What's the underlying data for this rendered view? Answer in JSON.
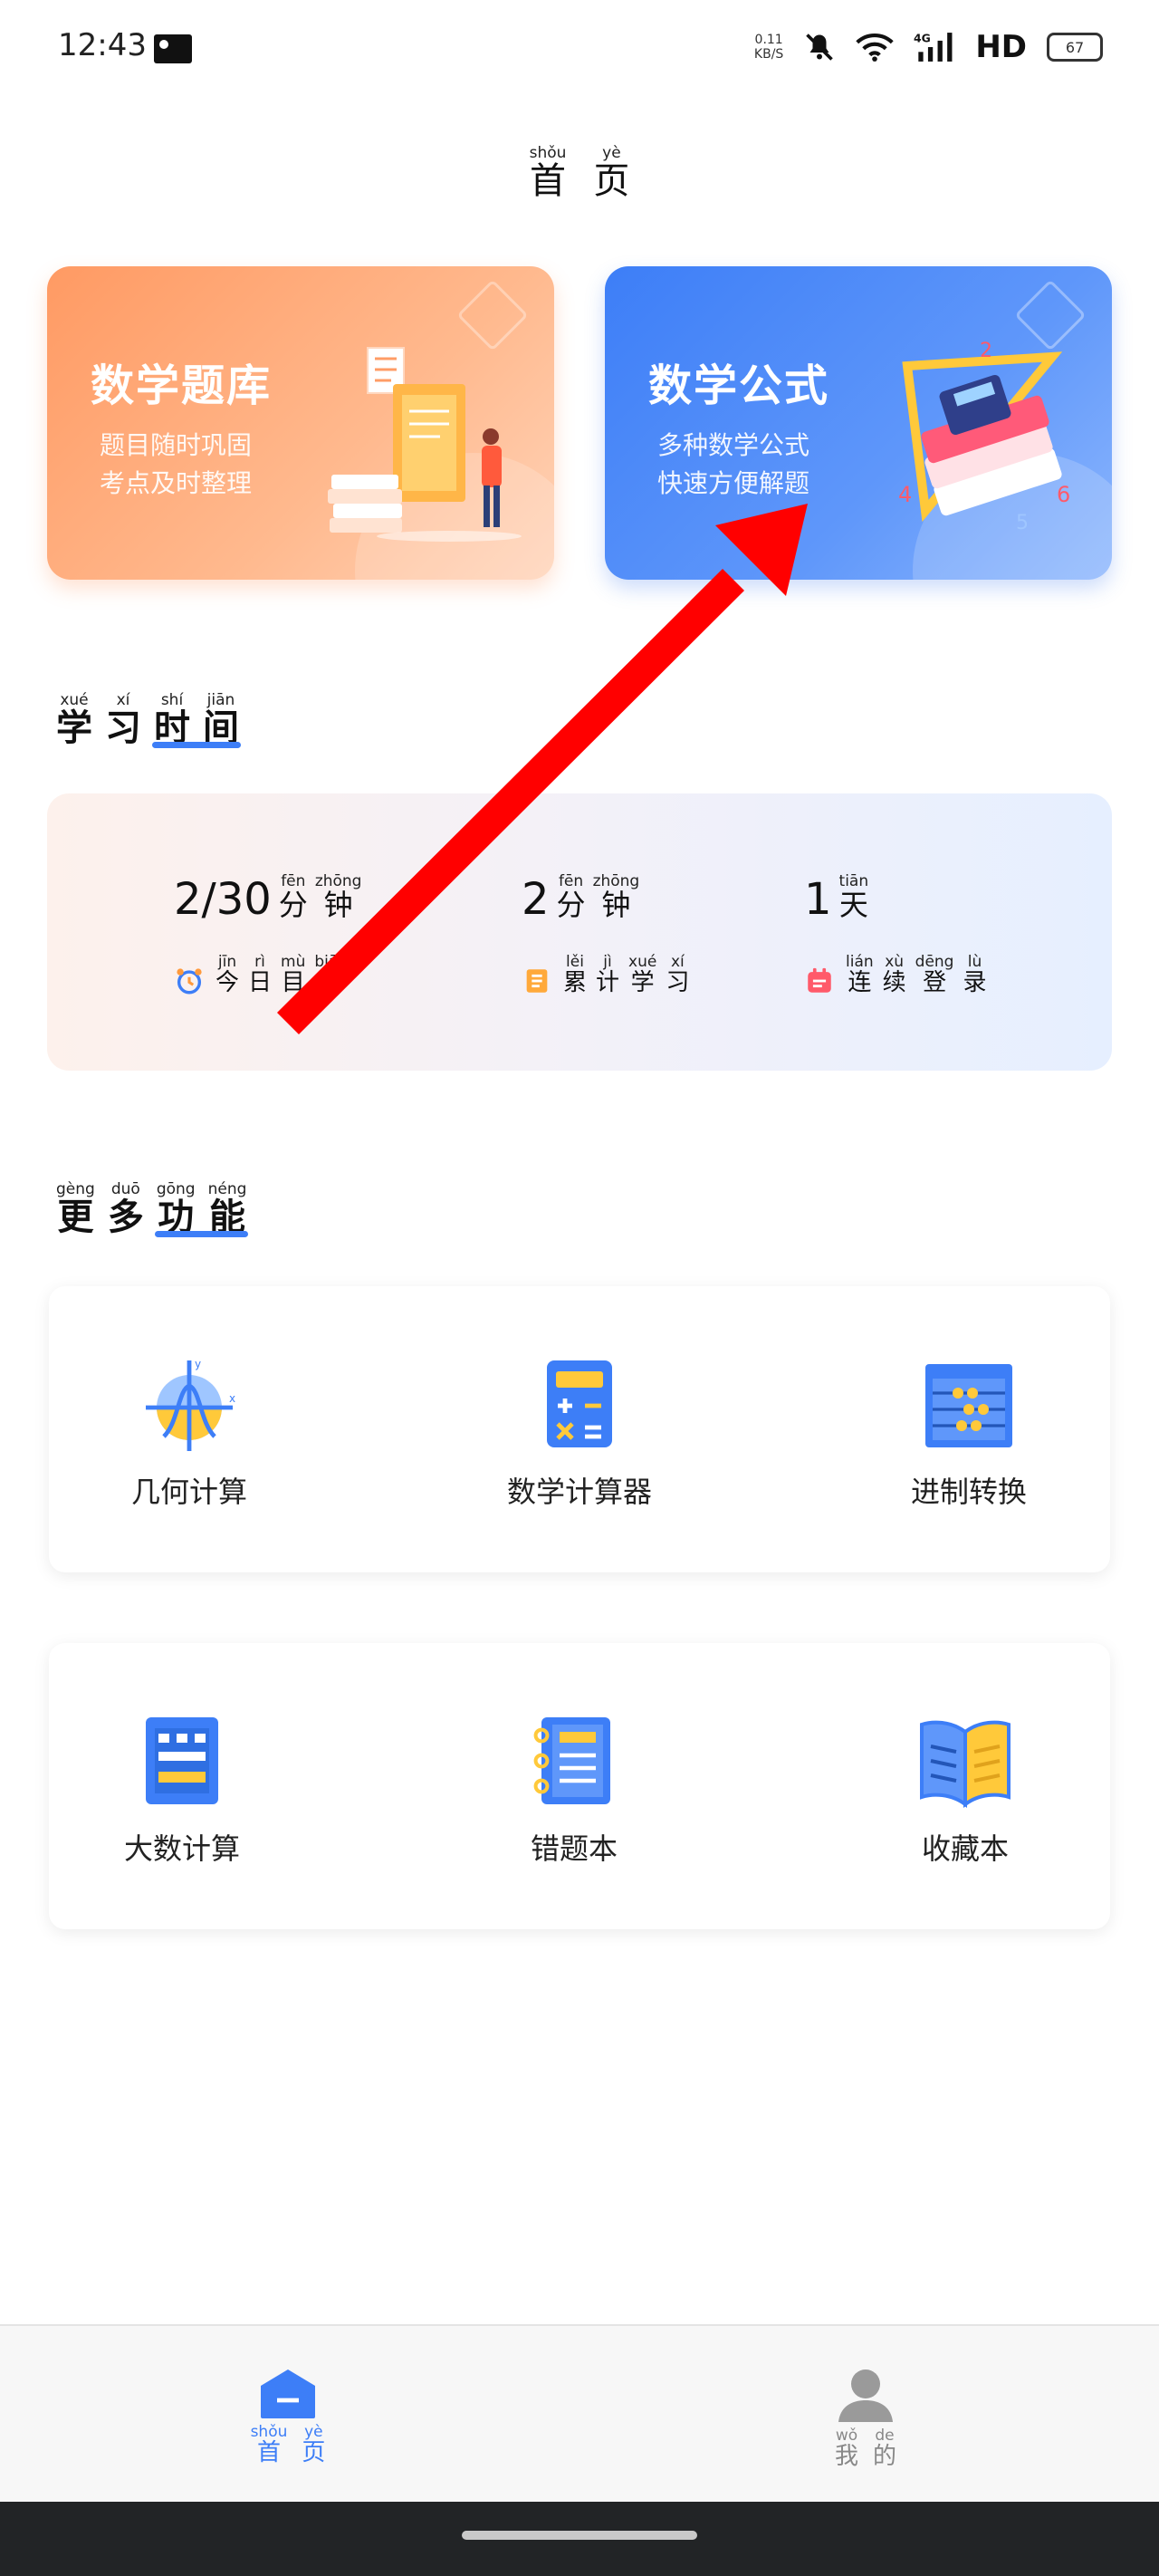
{
  "status_bar": {
    "time": "12:43",
    "net_speed_value": "0.11",
    "net_speed_unit": "KB/S",
    "network": "HD",
    "battery": "67"
  },
  "header": {
    "title": [
      {
        "py": "shǒu",
        "hz": "首"
      },
      {
        "py": "yè",
        "hz": "页"
      }
    ]
  },
  "cards": [
    {
      "title": "数学题库",
      "line1": "题目随时巩固",
      "line2": "考点及时整理"
    },
    {
      "title": "数学公式",
      "line1": "多种数学公式",
      "line2": "快速方便解题"
    }
  ],
  "study_section": {
    "title": [
      {
        "py": "xué",
        "hz": "学"
      },
      {
        "py": "xí",
        "hz": "习"
      },
      {
        "py": "shí",
        "hz": "时"
      },
      {
        "py": "jiān",
        "hz": "间"
      }
    ]
  },
  "stats": [
    {
      "value": "2/30",
      "unit": [
        {
          "py": "fēn",
          "hz": "分"
        },
        {
          "py": "zhōng",
          "hz": "钟"
        }
      ],
      "label": [
        {
          "py": "jīn",
          "hz": "今"
        },
        {
          "py": "rì",
          "hz": "日"
        },
        {
          "py": "mù",
          "hz": "目"
        },
        {
          "py": "biāo",
          "hz": "标"
        }
      ]
    },
    {
      "value": "2",
      "unit": [
        {
          "py": "fēn",
          "hz": "分"
        },
        {
          "py": "zhōng",
          "hz": "钟"
        }
      ],
      "label": [
        {
          "py": "lěi",
          "hz": "累"
        },
        {
          "py": "jì",
          "hz": "计"
        },
        {
          "py": "xué",
          "hz": "学"
        },
        {
          "py": "xí",
          "hz": "习"
        }
      ]
    },
    {
      "value": "1",
      "unit": [
        {
          "py": "tiān",
          "hz": "天"
        }
      ],
      "label": [
        {
          "py": "lián",
          "hz": "连"
        },
        {
          "py": "xù",
          "hz": "续"
        },
        {
          "py": "dēng",
          "hz": "登"
        },
        {
          "py": "lù",
          "hz": "录"
        }
      ]
    }
  ],
  "more_section": {
    "title": [
      {
        "py": "gèng",
        "hz": "更"
      },
      {
        "py": "duō",
        "hz": "多"
      },
      {
        "py": "gōng",
        "hz": "功"
      },
      {
        "py": "néng",
        "hz": "能"
      }
    ]
  },
  "functions": [
    {
      "label": "几何计算",
      "icon": "geometry-icon"
    },
    {
      "label": "数学计算器",
      "icon": "calculator-icon"
    },
    {
      "label": "进制转换",
      "icon": "abacus-icon"
    },
    {
      "label": "大数计算",
      "icon": "big-number-icon"
    },
    {
      "label": "错题本",
      "icon": "notebook-icon"
    },
    {
      "label": "收藏本",
      "icon": "book-icon"
    }
  ],
  "bottom_nav": {
    "home": [
      {
        "py": "shǒu",
        "hz": "首"
      },
      {
        "py": "yè",
        "hz": "页"
      }
    ],
    "me": [
      {
        "py": "wǒ",
        "hz": "我"
      },
      {
        "py": "de",
        "hz": "的"
      }
    ]
  },
  "colors": {
    "accent": "#3d7ef7",
    "orange_card": "#ff9a63",
    "blue_card": "#3d7ef7",
    "annotation_arrow": "#ff0000"
  }
}
